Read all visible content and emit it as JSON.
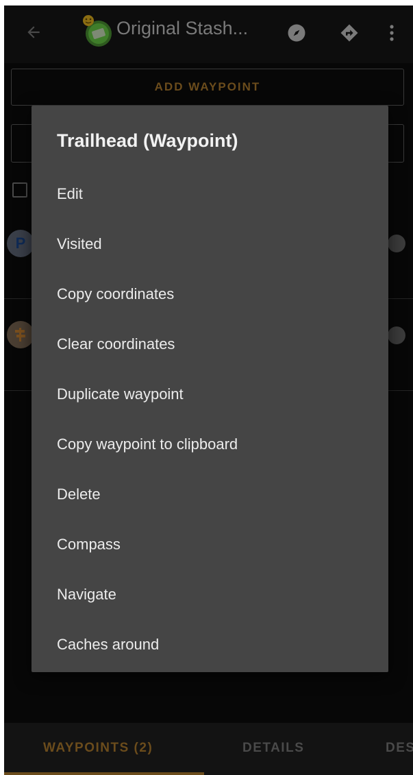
{
  "app_bar": {
    "title": "Original Stash...",
    "icons": [
      "back-arrow-icon",
      "geocache-icon",
      "compass-icon",
      "navigate-icon",
      "more-vert-icon"
    ]
  },
  "background": {
    "add_waypoint_label": "ADD WAYPOINT",
    "waypoint_markers": [
      "P"
    ]
  },
  "dialog": {
    "title": "Trailhead (Waypoint)",
    "items": [
      {
        "label": "Edit"
      },
      {
        "label": "Visited"
      },
      {
        "label": "Copy coordinates"
      },
      {
        "label": "Clear coordinates"
      },
      {
        "label": "Duplicate waypoint"
      },
      {
        "label": "Copy waypoint to clipboard"
      },
      {
        "label": "Delete"
      },
      {
        "label": "Compass"
      },
      {
        "label": "Navigate"
      },
      {
        "label": "Caches around"
      }
    ]
  },
  "tabs": [
    {
      "label": "WAYPOINTS (2)",
      "selected": true
    },
    {
      "label": "DETAILS",
      "selected": false
    },
    {
      "label": "DES",
      "selected": false
    }
  ],
  "colors": {
    "accent": "#6b4c1c",
    "dialog_bg": "#454545",
    "screen_bg": "#070707"
  }
}
